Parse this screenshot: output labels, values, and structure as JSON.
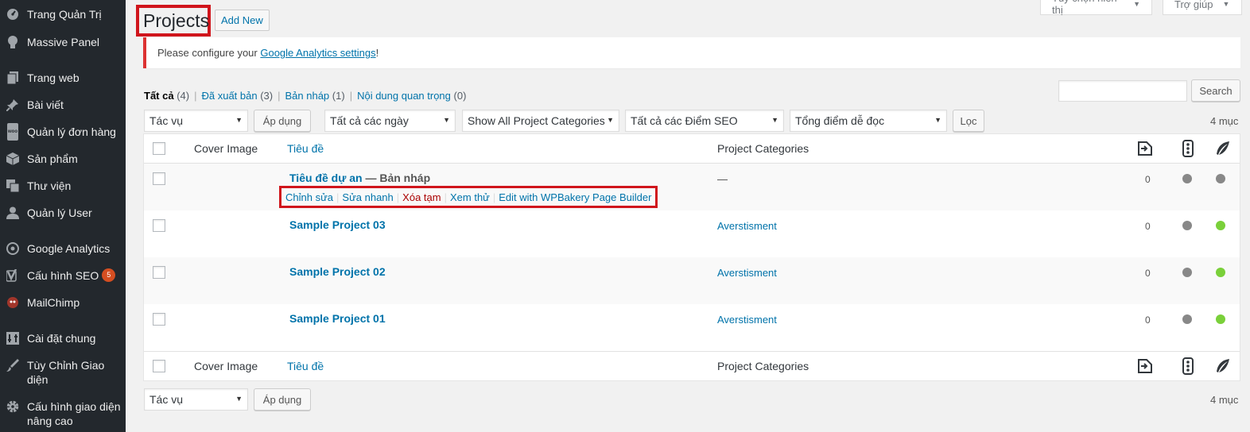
{
  "sidebar": {
    "items": [
      {
        "label": "Trang Quản Trị",
        "icon": "dashboard-icon"
      },
      {
        "label": "Massive Panel",
        "icon": "lightbulb-icon"
      },
      {
        "label": "Trang web",
        "icon": "pages-icon"
      },
      {
        "label": "Bài viết",
        "icon": "pin-icon"
      },
      {
        "label": "Quản lý đơn hàng",
        "icon": "woocommerce-icon",
        "icon_text": "woo"
      },
      {
        "label": "Sản phẩm",
        "icon": "box-icon"
      },
      {
        "label": "Thư viện",
        "icon": "media-icon"
      },
      {
        "label": "Quản lý User",
        "icon": "user-icon"
      },
      {
        "label": "Google Analytics",
        "icon": "analytics-icon"
      },
      {
        "label": "Cấu hình SEO",
        "icon": "yoast-icon",
        "badge": "5"
      },
      {
        "label": "MailChimp",
        "icon": "mailchimp-icon"
      },
      {
        "label": "Cài đặt chung",
        "icon": "settings-icon"
      },
      {
        "label": "Tùy Chỉnh Giao diện",
        "icon": "brush-icon"
      },
      {
        "label": "Cấu hình giao diện nâng cao",
        "icon": "gear-icon"
      }
    ]
  },
  "header": {
    "screen_options": "Tùy chọn hiển thị",
    "help": "Trợ giúp",
    "title": "Projects",
    "add_new": "Add New"
  },
  "notice": {
    "prefix": "Please configure your ",
    "link": "Google Analytics settings",
    "suffix": "!"
  },
  "views": [
    {
      "label": "Tất cả",
      "count": "(4)",
      "current": true
    },
    {
      "label": "Đã xuất bản",
      "count": "(3)"
    },
    {
      "label": "Bản nháp",
      "count": "(1)"
    },
    {
      "label": "Nội dung quan trọng",
      "count": "(0)"
    }
  ],
  "search": {
    "button": "Search",
    "value": ""
  },
  "filters": {
    "bulk_action": "Tác vụ",
    "apply": "Áp dụng",
    "dates": "Tất cả các ngày",
    "categories": "Show All Project Categories",
    "seo": "Tất cả các Điểm SEO",
    "readability": "Tổng điểm dễ đọc",
    "filter_btn": "Lọc",
    "items_count": "4 mục"
  },
  "table": {
    "columns": {
      "cover": "Cover Image",
      "title": "Tiêu đề",
      "categories": "Project Categories"
    },
    "rows": [
      {
        "title": "Tiêu đề dự an",
        "state": " — Bản nháp",
        "category": "—",
        "links": "0",
        "seo_color": "#888888",
        "read_color": "#888888"
      },
      {
        "title": "Sample Project 03",
        "state": "",
        "category": "Averstisment",
        "links": "0",
        "seo_color": "#888888",
        "read_color": "#7ad03a"
      },
      {
        "title": "Sample Project 02",
        "state": "",
        "category": "Averstisment",
        "links": "0",
        "seo_color": "#888888",
        "read_color": "#7ad03a"
      },
      {
        "title": "Sample Project 01",
        "state": "",
        "category": "Averstisment",
        "links": "0",
        "seo_color": "#888888",
        "read_color": "#7ad03a"
      }
    ],
    "row_actions": {
      "edit": "Chỉnh sửa",
      "quick_edit": "Sửa nhanh",
      "trash": "Xóa tạm",
      "view": "Xem thử",
      "wpbakery": "Edit with WPBakery Page Builder"
    }
  },
  "bottom": {
    "bulk_action": "Tác vụ",
    "apply": "Áp dụng",
    "items_count": "4 mục"
  },
  "colors": {
    "sidebar_bg": "#23282d",
    "link": "#0073aa",
    "highlight_border": "#d0151c",
    "seo_good": "#7ad03a",
    "seo_na": "#888888"
  }
}
